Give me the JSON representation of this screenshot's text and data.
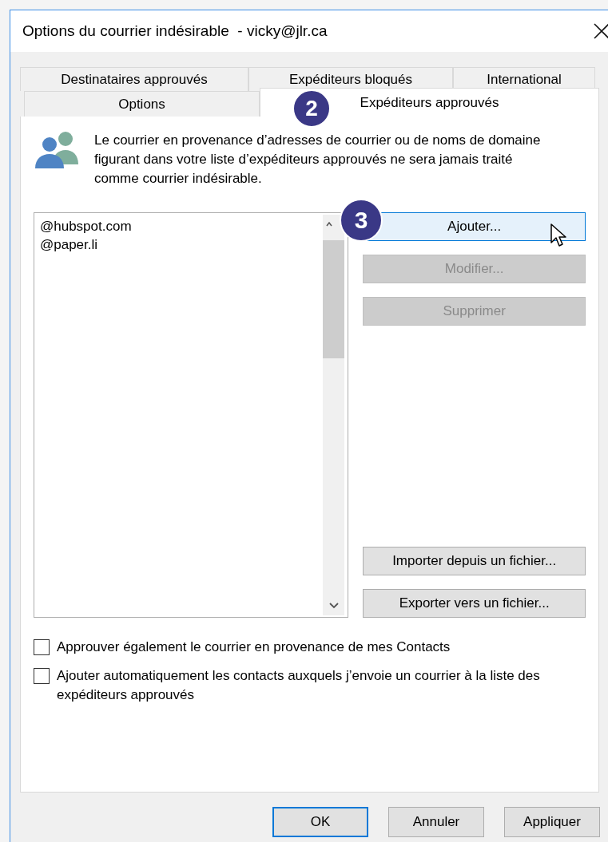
{
  "window": {
    "title": "Options du courrier indésirable  - vicky@jlr.ca"
  },
  "tab_rows": [
    {
      "tabs": [
        {
          "label": "Destinataires approuvés",
          "selected": false
        },
        {
          "label": "Expéditeurs bloqués",
          "selected": false
        },
        {
          "label": "International",
          "selected": false
        }
      ]
    },
    {
      "tabs": [
        {
          "label": "Options",
          "selected": false
        },
        {
          "label": "Expéditeurs approuvés",
          "selected": true
        }
      ]
    }
  ],
  "description": "Le courrier en provenance d’adresses de courrier ou de noms de domaine figurant dans votre liste d’expéditeurs approuvés ne sera jamais traité comme courrier indésirable.",
  "addresses": [
    "@hubspot.com",
    "@paper.li"
  ],
  "edit_buttons": [
    {
      "label": "Ajouter...",
      "disabled": false,
      "hovered": true
    },
    {
      "label": "Modifier...",
      "disabled": true,
      "hovered": false
    },
    {
      "label": "Supprimer",
      "disabled": true,
      "hovered": false
    }
  ],
  "file_buttons": [
    {
      "label": "Importer depuis un fichier...",
      "disabled": false,
      "hovered": false
    },
    {
      "label": "Exporter vers un fichier...",
      "disabled": false,
      "hovered": false
    }
  ],
  "options": [
    {
      "label": "Approuver également le courrier en provenance de mes Contacts",
      "checked": false
    },
    {
      "label": "Ajouter automatiquement les contacts auxquels j’envoie un courrier à la liste des expéditeurs approuvés",
      "checked": false
    }
  ],
  "footer_buttons": [
    {
      "label": "OK",
      "default": true
    },
    {
      "label": "Annuler",
      "default": false
    },
    {
      "label": "Appliquer",
      "default": false
    }
  ],
  "step_badges": [
    "2",
    "3"
  ]
}
